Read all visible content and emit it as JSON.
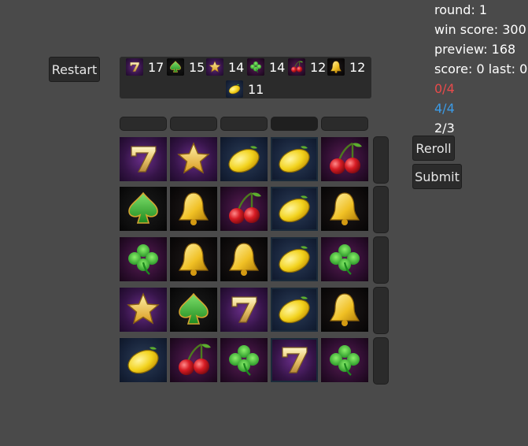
{
  "buttons": {
    "restart": "Restart",
    "reroll": "Reroll",
    "submit": "Submit"
  },
  "stats": {
    "round": "round: 1",
    "win_score": "win score: 300",
    "preview": "preview: 168",
    "score": "score: 0 last: 0",
    "counter_red": "0/4",
    "counter_blue": "4/4",
    "counter_white": "2/3"
  },
  "colors": {
    "red": "#e84a4a",
    "blue": "#3b9be6",
    "white": "#ffffff"
  },
  "symbol_counts": [
    {
      "icon": "seven-icon",
      "count": "17"
    },
    {
      "icon": "spade-icon",
      "count": "15"
    },
    {
      "icon": "star-icon",
      "count": "14"
    },
    {
      "icon": "clover-icon",
      "count": "14"
    },
    {
      "icon": "cherry-icon",
      "count": "12"
    },
    {
      "icon": "bell-icon",
      "count": "12"
    },
    {
      "icon": "lemon-icon",
      "count": "11"
    }
  ],
  "grid": [
    [
      "seven",
      "star",
      "lemon",
      "lemon",
      "cherry"
    ],
    [
      "spade",
      "bell",
      "cherry",
      "lemon",
      "bell"
    ],
    [
      "clover",
      "bell",
      "bell",
      "lemon",
      "clover"
    ],
    [
      "star",
      "spade",
      "seven",
      "lemon",
      "bell"
    ],
    [
      "lemon",
      "cherry",
      "clover",
      "seven",
      "clover"
    ]
  ]
}
